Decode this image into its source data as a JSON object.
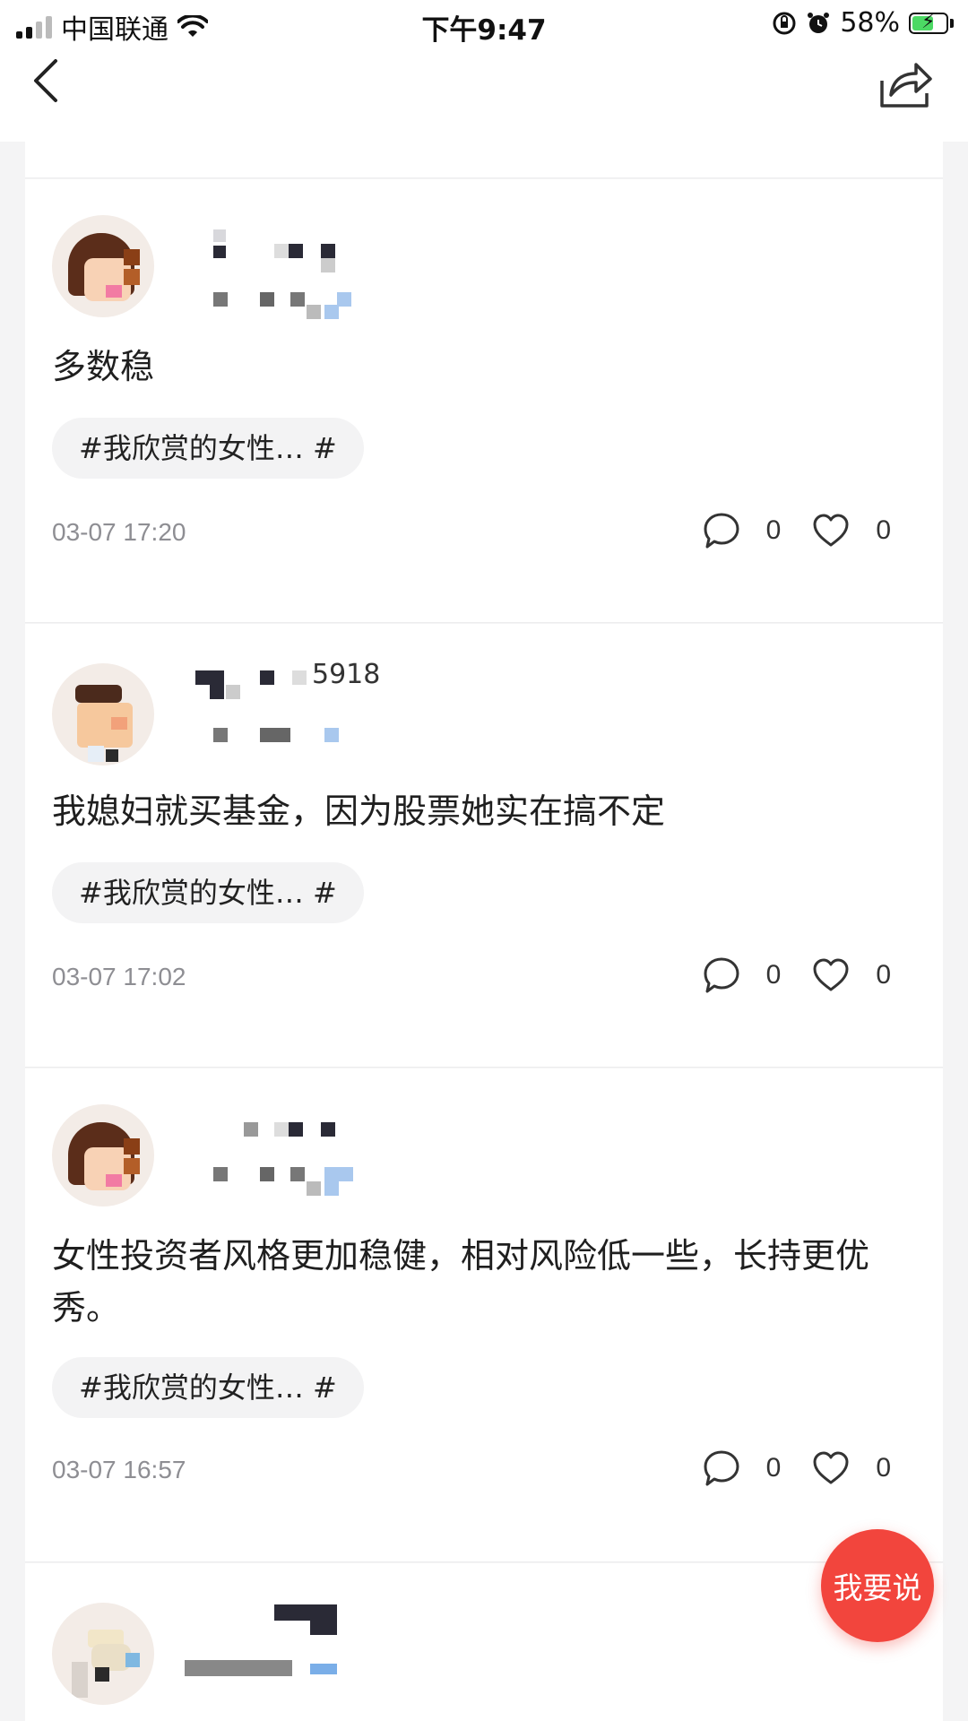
{
  "status_bar": {
    "carrier": "中国联通",
    "time": "下午9:47",
    "battery": "58%"
  },
  "nav": {
    "back_icon": "chevron-left-icon",
    "share_icon": "share-icon"
  },
  "posts": [
    {
      "username": "",
      "text": "多数稳",
      "topic": "#我欣赏的女性… #",
      "time": "03-07 17:20",
      "comments": "0",
      "likes": "0"
    },
    {
      "username": "5918",
      "text": "我媳妇就买基金，因为股票她实在搞不定",
      "topic": "#我欣赏的女性… #",
      "time": "03-07 17:02",
      "comments": "0",
      "likes": "0"
    },
    {
      "username": "",
      "text": "女性投资者风格更加稳健，相对风险低一些，长持更优秀。",
      "topic": "#我欣赏的女性… #",
      "time": "03-07 16:57",
      "comments": "0",
      "likes": "0"
    },
    {
      "username": ""
    }
  ],
  "fab": {
    "label": "我要说"
  }
}
